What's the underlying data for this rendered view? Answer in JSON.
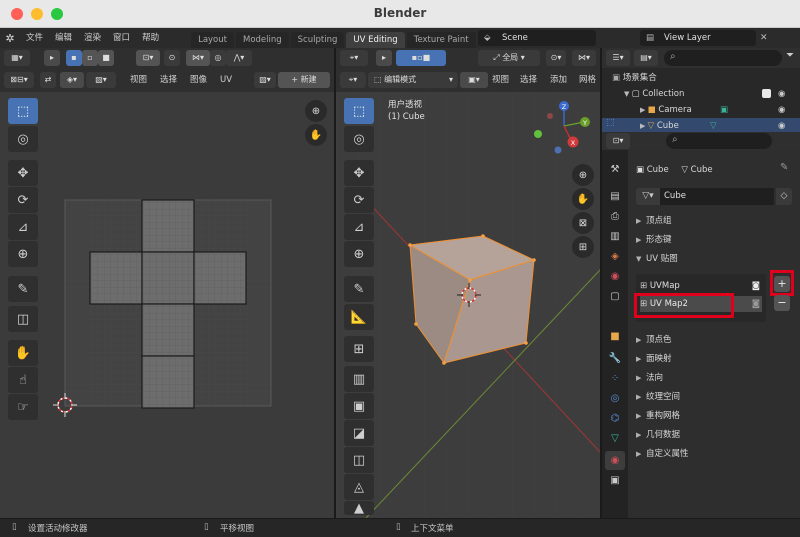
{
  "window": {
    "title": "Blender"
  },
  "menu": [
    "文件",
    "编辑",
    "渲染",
    "窗口",
    "帮助"
  ],
  "workspaces": [
    "Layout",
    "Modeling",
    "Sculpting",
    "UV Editing",
    "Texture Paint"
  ],
  "active_workspace": "UV Editing",
  "scene": "Scene",
  "view_layer": "View Layer",
  "uv_editor": {
    "menus": [
      "视图",
      "选择",
      "图像",
      "UV"
    ],
    "new_button": "新建"
  },
  "viewport": {
    "mode": "编辑模式",
    "transform": "全局",
    "menus": [
      "视图",
      "选择",
      "添加",
      "网格"
    ],
    "view_name": "用户透视",
    "object_label": "(1) Cube",
    "gizmo_labels": {
      "x": "X",
      "y": "Y",
      "z": "Z"
    }
  },
  "outliner": {
    "scene_collection": "场景集合",
    "collection": "Collection",
    "items": [
      "Camera",
      "Cube"
    ]
  },
  "properties": {
    "breadcrumb": [
      "Cube",
      "Cube"
    ],
    "mesh_name": "Cube",
    "sections_top": [
      "顶点组",
      "形态键"
    ],
    "uv_section": "UV 贴图",
    "uv_maps": [
      "UVMap",
      "UV Map2"
    ],
    "add_symbol": "+",
    "remove_symbol": "−",
    "sections_bottom": [
      "顶点色",
      "面映射",
      "法向",
      "纹理空间",
      "重构网格",
      "几何数据",
      "自定义属性"
    ]
  },
  "status_bar": [
    "设置活动修改器",
    "平移视图",
    "上下文菜单"
  ],
  "colors": {
    "accent": "#4772b3",
    "highlight_red": "#e0001b",
    "selection_orange": "#f09030",
    "object_fill": "#a89288"
  }
}
